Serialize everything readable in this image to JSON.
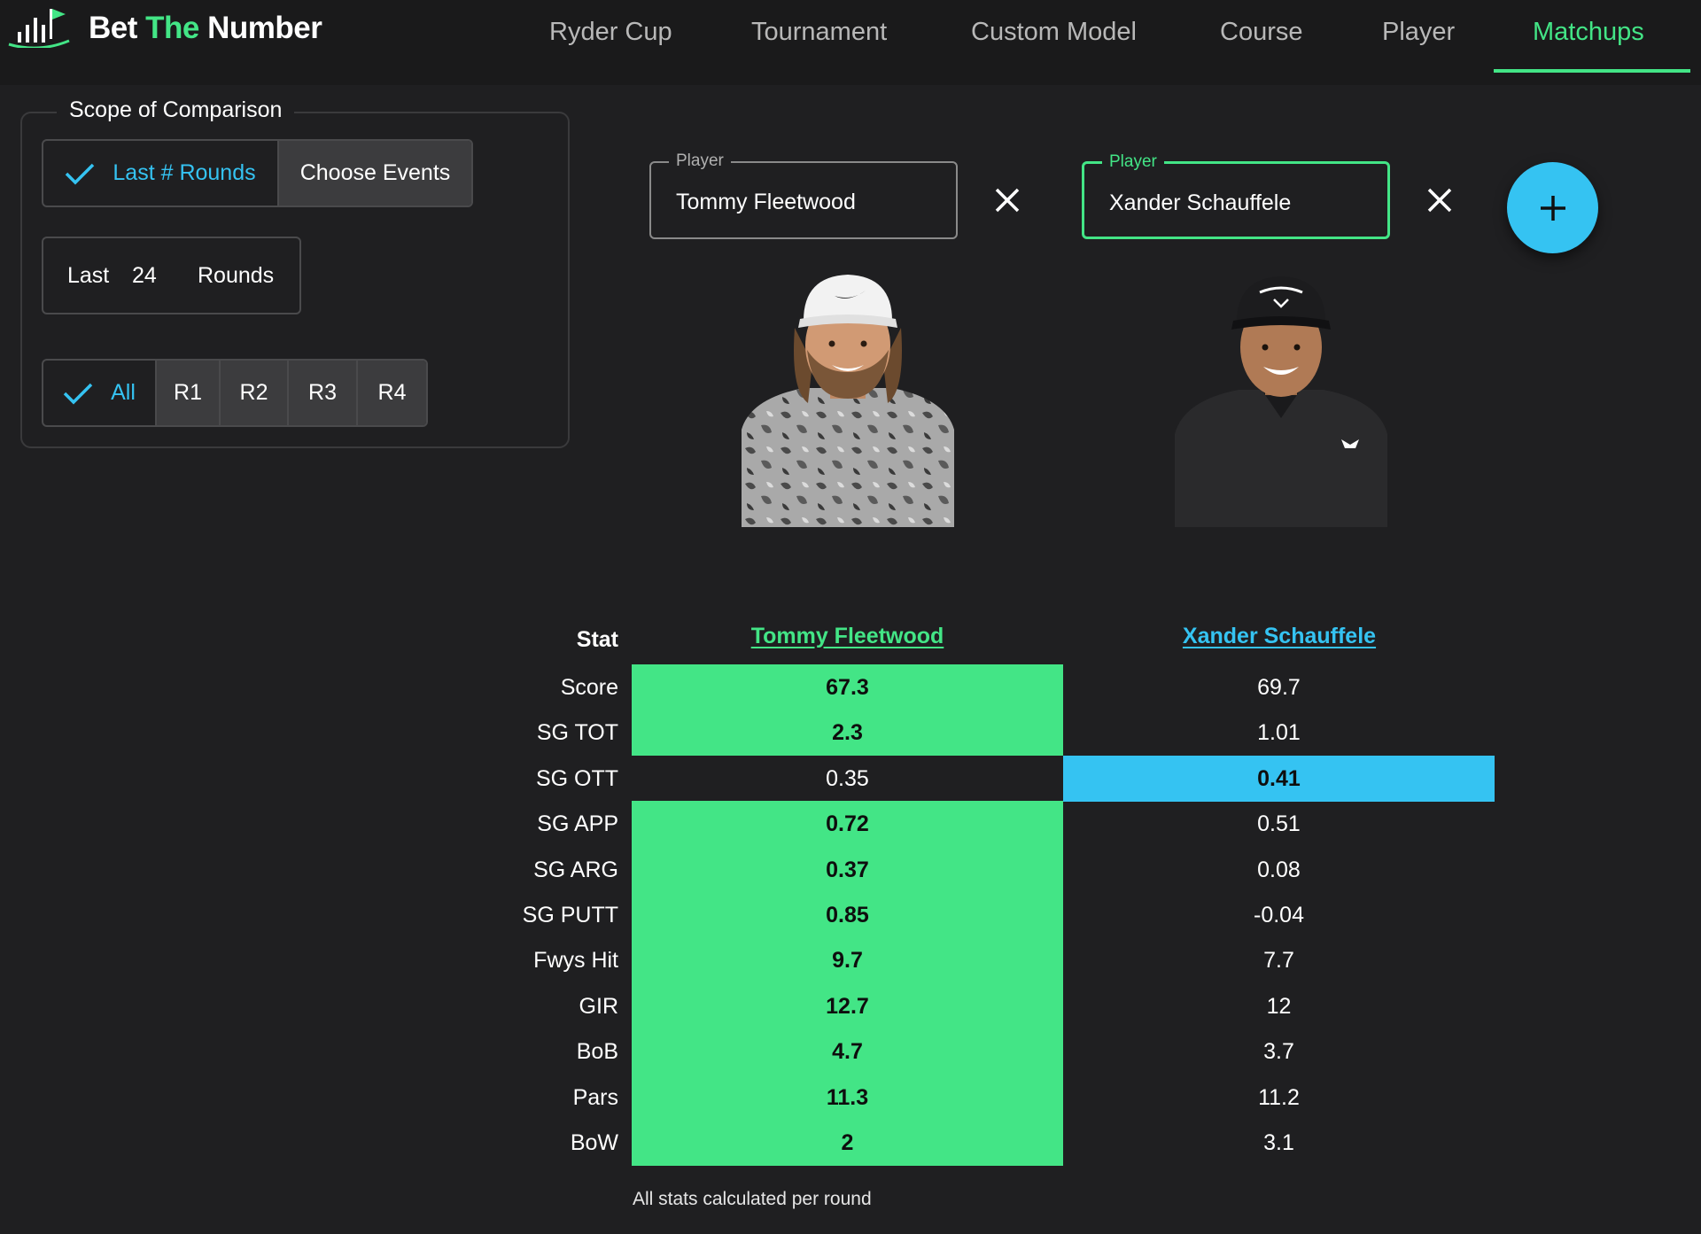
{
  "brand": {
    "part1": "Bet",
    "part2": "The",
    "part3": "Number"
  },
  "nav": [
    {
      "label": "Ryder Cup"
    },
    {
      "label": "Tournament"
    },
    {
      "label": "Custom Model"
    },
    {
      "label": "Course"
    },
    {
      "label": "Player"
    },
    {
      "label": "Matchups",
      "active": true
    }
  ],
  "scope": {
    "title": "Scope of Comparison",
    "mode_options": [
      "Last # Rounds",
      "Choose Events"
    ],
    "mode_selected": "Last # Rounds",
    "rounds_prefix": "Last",
    "rounds_value": "24",
    "rounds_suffix": "Rounds",
    "round_filters": [
      "All",
      "R1",
      "R2",
      "R3",
      "R4"
    ],
    "round_selected": "All"
  },
  "players": [
    {
      "field_label": "Player",
      "name": "Tommy Fleetwood",
      "color": "#43e586"
    },
    {
      "field_label": "Player",
      "name": "Xander Schauffele",
      "color": "#35c3f2"
    }
  ],
  "table": {
    "stat_header": "Stat",
    "rows": [
      {
        "stat": "Score",
        "p1": "67.3",
        "p2": "69.7",
        "winner": 1
      },
      {
        "stat": "SG TOT",
        "p1": "2.3",
        "p2": "1.01",
        "winner": 1
      },
      {
        "stat": "SG OTT",
        "p1": "0.35",
        "p2": "0.41",
        "winner": 2
      },
      {
        "stat": "SG APP",
        "p1": "0.72",
        "p2": "0.51",
        "winner": 1
      },
      {
        "stat": "SG ARG",
        "p1": "0.37",
        "p2": "0.08",
        "winner": 1
      },
      {
        "stat": "SG PUTT",
        "p1": "0.85",
        "p2": "-0.04",
        "winner": 1
      },
      {
        "stat": "Fwys Hit",
        "p1": "9.7",
        "p2": "7.7",
        "winner": 1
      },
      {
        "stat": "GIR",
        "p1": "12.7",
        "p2": "12",
        "winner": 1
      },
      {
        "stat": "BoB",
        "p1": "4.7",
        "p2": "3.7",
        "winner": 1
      },
      {
        "stat": "Pars",
        "p1": "11.3",
        "p2": "11.2",
        "winner": 1
      },
      {
        "stat": "BoW",
        "p1": "2",
        "p2": "3.1",
        "winner": 1
      }
    ],
    "footnote": "All stats calculated per round"
  },
  "colors": {
    "accent_green": "#43e586",
    "accent_blue": "#35c3f2",
    "background": "#1f1f21"
  },
  "icons": [
    "bet-the-number-logo-icon",
    "check-icon",
    "close-icon",
    "plus-icon"
  ]
}
